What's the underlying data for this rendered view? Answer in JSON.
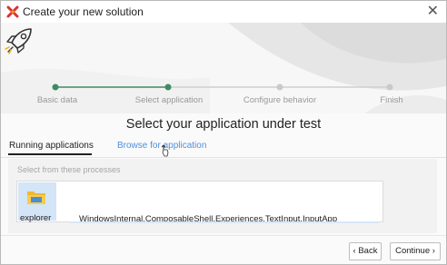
{
  "window": {
    "title": "Create your new solution",
    "close_glyph": "✕"
  },
  "wizard": {
    "steps": [
      {
        "label": "Basic data",
        "state": "done"
      },
      {
        "label": "Select application",
        "state": "active"
      },
      {
        "label": "Configure behavior",
        "state": "pending"
      },
      {
        "label": "Finish",
        "state": "pending"
      }
    ],
    "heading": "Select your application under test",
    "accent_color": "#3f8a63"
  },
  "tabs": {
    "running": "Running applications",
    "browse": "Browse for application"
  },
  "processes": {
    "section_label": "Select from these processes",
    "items": [
      {
        "name": "explorer",
        "description": "WindowsInternal.ComposableShell.Experiences.TextInput.InputApp",
        "icon": "folder-icon"
      }
    ]
  },
  "footer": {
    "back": "‹ Back",
    "continue": "Continue ›"
  }
}
